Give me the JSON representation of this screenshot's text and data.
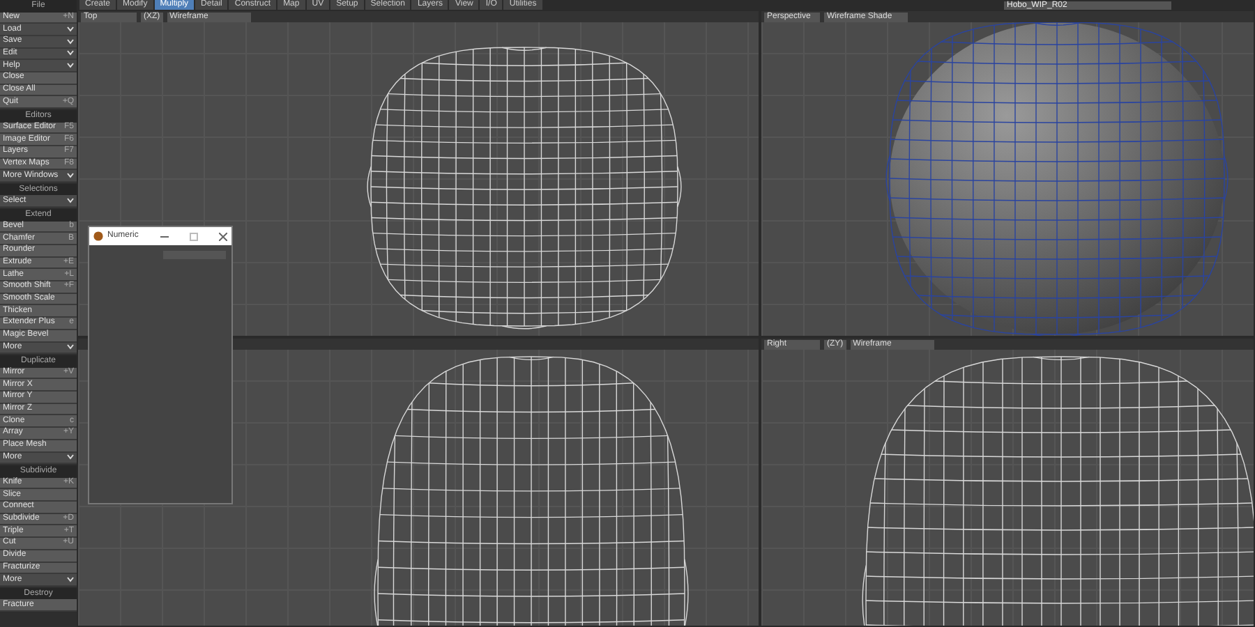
{
  "file_name": "Hobo_WIP_R02",
  "tabs": [
    {
      "label": "Create",
      "selected": false
    },
    {
      "label": "Modify",
      "selected": false
    },
    {
      "label": "Multiply",
      "selected": true
    },
    {
      "label": "Detail",
      "selected": false
    },
    {
      "label": "Construct",
      "selected": false
    },
    {
      "label": "Map",
      "selected": false
    },
    {
      "label": "UV",
      "selected": false
    },
    {
      "label": "Setup",
      "selected": false
    },
    {
      "label": "Selection",
      "selected": false
    },
    {
      "label": "Layers",
      "selected": false
    },
    {
      "label": "View",
      "selected": false
    },
    {
      "label": "I/O",
      "selected": false
    },
    {
      "label": "Utilities",
      "selected": false
    }
  ],
  "sidebar": [
    {
      "title": "File",
      "items": [
        {
          "label": "New",
          "shortcut": "+N",
          "kind": "item"
        },
        {
          "label": "Load",
          "kind": "menu"
        },
        {
          "label": "Save",
          "kind": "menu"
        },
        {
          "label": "Edit",
          "kind": "menu"
        },
        {
          "label": "Help",
          "kind": "menu"
        },
        {
          "label": "Close",
          "kind": "item"
        },
        {
          "label": "Close All",
          "kind": "item"
        },
        {
          "label": "Quit",
          "shortcut": "+Q",
          "kind": "item"
        }
      ]
    },
    {
      "title": "Editors",
      "items": [
        {
          "label": "Surface Editor",
          "shortcut": "F5",
          "kind": "item"
        },
        {
          "label": "Image Editor",
          "shortcut": "F6",
          "kind": "item"
        },
        {
          "label": "Layers",
          "shortcut": "F7",
          "kind": "item"
        },
        {
          "label": "Vertex Maps",
          "shortcut": "F8",
          "kind": "item"
        },
        {
          "label": "More Windows",
          "kind": "menu"
        }
      ]
    },
    {
      "title": "Selections",
      "items": [
        {
          "label": "Select",
          "kind": "menu"
        }
      ]
    },
    {
      "title": "Extend",
      "items": [
        {
          "label": "Bevel",
          "shortcut": "b",
          "kind": "item"
        },
        {
          "label": "Chamfer",
          "shortcut": "B",
          "kind": "item"
        },
        {
          "label": "Rounder",
          "kind": "item"
        },
        {
          "label": "Extrude",
          "shortcut": "+E",
          "kind": "item"
        },
        {
          "label": "Lathe",
          "shortcut": "+L",
          "kind": "item"
        },
        {
          "label": "Smooth Shift",
          "shortcut": "+F",
          "kind": "item"
        },
        {
          "label": "Smooth Scale",
          "kind": "item"
        },
        {
          "label": "Thicken",
          "kind": "item"
        },
        {
          "label": "Extender Plus",
          "shortcut": "e",
          "kind": "item"
        },
        {
          "label": "Magic Bevel",
          "kind": "item"
        },
        {
          "label": "More",
          "kind": "menu"
        }
      ]
    },
    {
      "title": "Duplicate",
      "items": [
        {
          "label": "Mirror",
          "shortcut": "+V",
          "kind": "item"
        },
        {
          "label": "Mirror X",
          "kind": "item"
        },
        {
          "label": "Mirror Y",
          "kind": "item"
        },
        {
          "label": "Mirror Z",
          "kind": "item"
        },
        {
          "label": "Clone",
          "shortcut": "c",
          "kind": "item"
        },
        {
          "label": "Array",
          "shortcut": "+Y",
          "kind": "item"
        },
        {
          "label": "Place Mesh",
          "kind": "item"
        },
        {
          "label": "More",
          "kind": "menu"
        }
      ]
    },
    {
      "title": "Subdivide",
      "items": [
        {
          "label": "Knife",
          "shortcut": "+K",
          "kind": "item"
        },
        {
          "label": "Slice",
          "kind": "item"
        },
        {
          "label": "Connect",
          "kind": "item"
        },
        {
          "label": "Subdivide",
          "shortcut": "+D",
          "kind": "item"
        },
        {
          "label": "Triple",
          "shortcut": "+T",
          "kind": "item"
        },
        {
          "label": "Cut",
          "shortcut": "+U",
          "kind": "item"
        },
        {
          "label": "Divide",
          "kind": "item"
        },
        {
          "label": "Fracturize",
          "kind": "item"
        },
        {
          "label": "More",
          "kind": "menu"
        }
      ]
    },
    {
      "title": "Destroy",
      "items": [
        {
          "label": "Fracture",
          "kind": "item"
        }
      ]
    }
  ],
  "viewports": [
    {
      "view": "Top",
      "axes": "(XZ)",
      "mode": "Wireframe",
      "kind": "wire-top"
    },
    {
      "view": "Perspective",
      "mode": "Wireframe Shade",
      "kind": "shaded"
    },
    {
      "kind": "wire-front"
    },
    {
      "view": "Right",
      "axes": "(ZY)",
      "mode": "Wireframe",
      "kind": "wire-side"
    }
  ],
  "numeric": {
    "title": "Numeric"
  }
}
